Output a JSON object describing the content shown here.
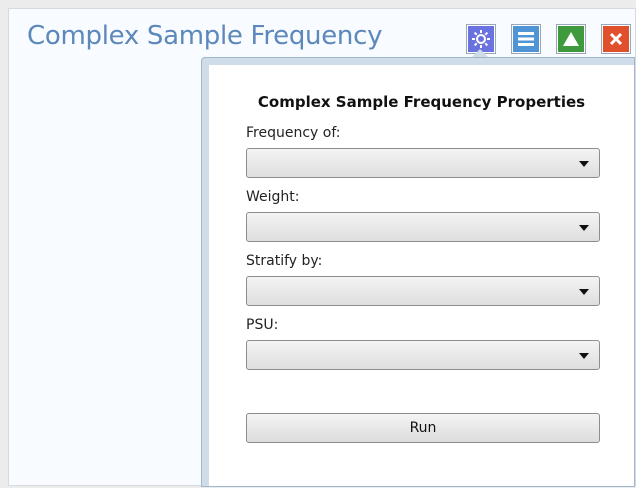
{
  "gadget": {
    "title": "Complex Sample Frequency",
    "buttons": [
      {
        "icon": "gear-icon",
        "color": "#6a72e0"
      },
      {
        "icon": "list-icon",
        "color": "#4f94d4"
      },
      {
        "icon": "triangle-up-icon",
        "color": "#3e9a3c"
      },
      {
        "icon": "close-icon",
        "color": "#e0502c"
      }
    ]
  },
  "properties": {
    "title": "Complex Sample Frequency Properties",
    "fields": [
      {
        "label": "Frequency of:",
        "value": ""
      },
      {
        "label": "Weight:",
        "value": ""
      },
      {
        "label": "Stratify by:",
        "value": ""
      },
      {
        "label": "PSU:",
        "value": ""
      }
    ],
    "run_label": "Run"
  },
  "colors": {
    "title": "#5c88ba",
    "popup_border": "#cfddea"
  }
}
